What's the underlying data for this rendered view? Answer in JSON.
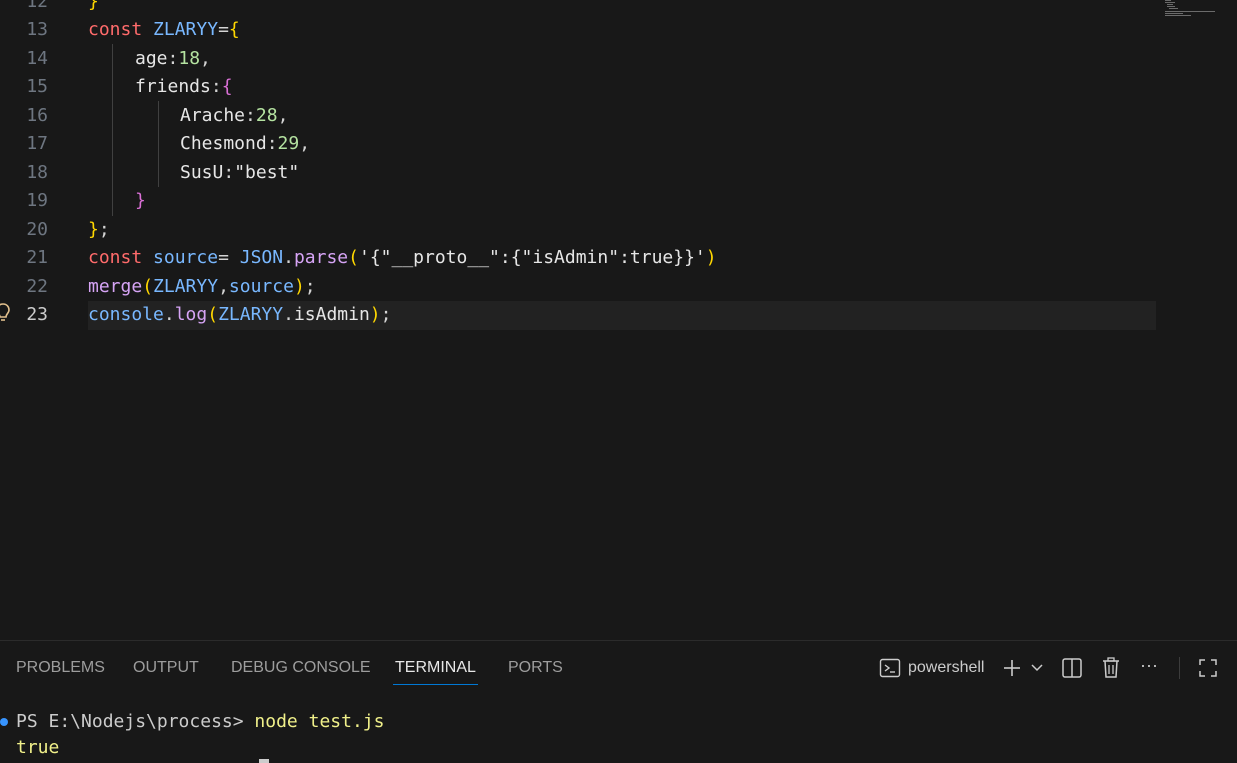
{
  "editor": {
    "lines": [
      {
        "no": "12",
        "text": "}"
      },
      {
        "no": "13",
        "text": "const ZLARYY={"
      },
      {
        "no": "14",
        "text": "age:18,"
      },
      {
        "no": "15",
        "text": "friends:{"
      },
      {
        "no": "16",
        "text": "Arache:28,"
      },
      {
        "no": "17",
        "text": "Chesmond:29,"
      },
      {
        "no": "18",
        "text": "SusU:\"best\""
      },
      {
        "no": "19",
        "text": "}"
      },
      {
        "no": "20",
        "text": "};"
      },
      {
        "no": "21",
        "text": "const source= JSON.parse('{\"__proto__\":{\"isAdmin\":true}}')"
      },
      {
        "no": "22",
        "text": "merge(ZLARYY,source);"
      },
      {
        "no": "23",
        "text": "console.log(ZLARYY.isAdmin);"
      }
    ]
  },
  "panel": {
    "tabs": [
      {
        "label": "PROBLEMS"
      },
      {
        "label": "OUTPUT"
      },
      {
        "label": "DEBUG CONSOLE"
      },
      {
        "label": "TERMINAL"
      },
      {
        "label": "PORTS"
      }
    ],
    "active_tab": "TERMINAL",
    "shell_label": "powershell",
    "more_label": "···"
  },
  "terminal": {
    "prompt": "PS E:\\Nodejs\\process> ",
    "command": "node test.js",
    "output": "true"
  },
  "colors": {
    "accent": "#0078d4",
    "background": "#181818"
  }
}
